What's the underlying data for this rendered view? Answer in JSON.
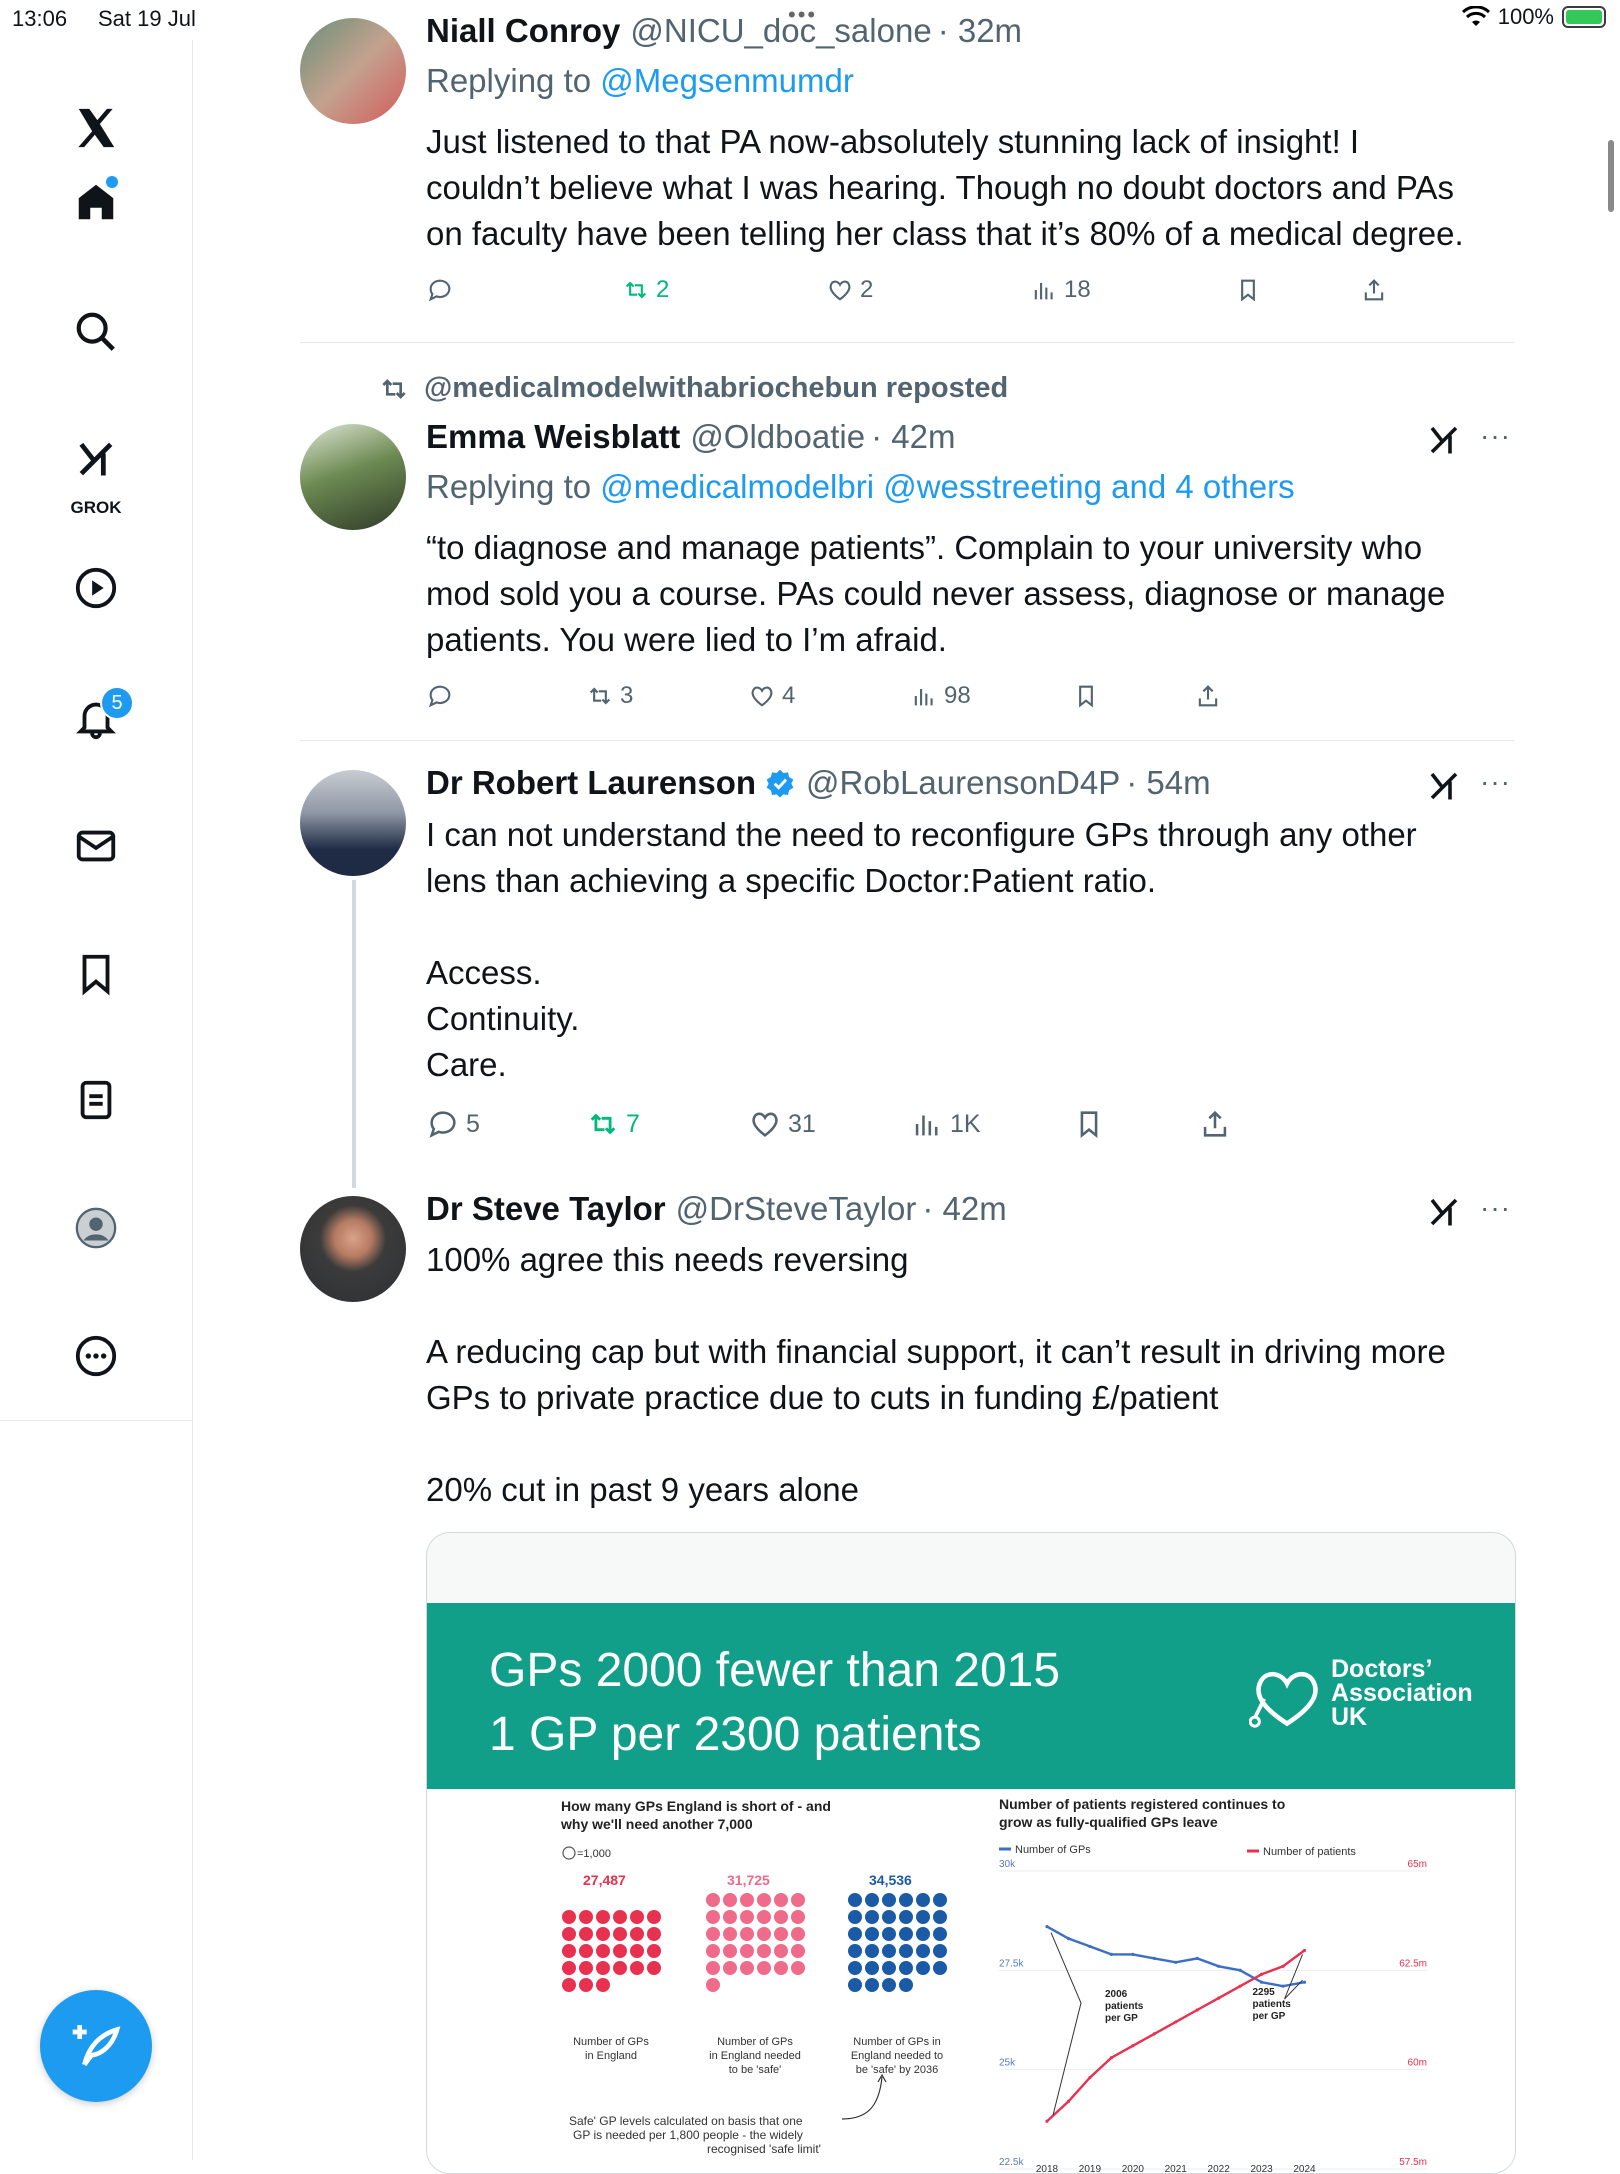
{
  "status_bar": {
    "time": "13:06",
    "date": "Sat 19 Jul",
    "battery": "100%"
  },
  "sidebar": {
    "grok_label": "GROK",
    "notification_count": "5"
  },
  "tweets": [
    {
      "name": "Niall Conroy",
      "handle": "@NICU_doc_salone",
      "time": "· 32m",
      "replying_prefix": "Replying to ",
      "replying_to": "@Megsenmumdr",
      "text": "Just listened to that PA now-absolutely stunning lack of insight! I\ncouldn’t believe what I was hearing. Though no doubt doctors and PAs\non faculty have been telling her class that it’s 80% of a medical degree.",
      "replies": "",
      "reposts": "2",
      "likes": "2",
      "views": "18"
    },
    {
      "reposted_by": "@medicalmodelwithabriochebun reposted",
      "name": "Emma Weisblatt",
      "handle": "@Oldboatie",
      "time": "· 42m",
      "replying_prefix": "Replying to ",
      "replying_to": "@medicalmodelbri @wesstreeting and 4 others",
      "text": "“to diagnose and manage patients”. Complain to your university who\nmod sold you a course. PAs could never assess, diagnose or manage\npatients. You were lied to I’m afraid.",
      "replies": "",
      "reposts": "3",
      "likes": "4",
      "views": "98"
    },
    {
      "name": "Dr Robert Laurenson",
      "handle": "@RobLaurensonD4P",
      "time": "· 54m",
      "text": "I can not understand the need to reconfigure GPs through any other\nlens than achieving a specific Doctor:Patient ratio.\n\nAccess.\nContinuity.\nCare.",
      "replies": "5",
      "reposts": "7",
      "likes": "31",
      "views": "1K"
    },
    {
      "name": "Dr Steve Taylor",
      "handle": "@DrSteveTaylor",
      "time": "· 42m",
      "text": "100% agree this needs reversing\n\nA reducing cap but with financial support, it can’t result in driving more\nGPs to private practice due to cuts in funding £/patient\n\n20% cut in past 9 years alone"
    }
  ],
  "card": {
    "banner_line1": "GPs 2000 fewer than 2015",
    "banner_line2": "1 GP per 2300 patients",
    "org_line1": "Doctors’",
    "org_line2": "Association",
    "org_line3": "UK",
    "left_title_1": "How many GPs England is short of - and",
    "left_title_2": "why we'll need another 7,000",
    "legend_unit": "=1,000",
    "groups": [
      {
        "value": "27,487",
        "label_1": "Number of GPs",
        "label_2": "in England",
        "label_3": "",
        "color": "#e8304f"
      },
      {
        "value": "31,725",
        "label_1": "Number of GPs",
        "label_2": "in England needed",
        "label_3": "to be 'safe'",
        "color": "#f06b8a"
      },
      {
        "value": "34,536",
        "label_1": "Number of GPs in",
        "label_2": "England needed to",
        "label_3": "be 'safe' by 2036",
        "color": "#1a5aa6"
      }
    ],
    "footnote_1": "Safe' GP levels calculated on basis that one",
    "footnote_2": "GP is needed per 1,800 people - the widely",
    "footnote_3": "recognised 'safe limit'",
    "right_title_1": "Number of patients registered continues to",
    "right_title_2": "grow as fully-qualified GPs leave",
    "legend_gps": "Number of GPs",
    "legend_patients": "Number of patients",
    "gp_color": "#3a6fc4",
    "patient_color": "#e8304f",
    "y_left": [
      "30k",
      "27.5k",
      "25k",
      "22.5k"
    ],
    "y_right": [
      "65m",
      "62.5m",
      "60m",
      "57.5m"
    ],
    "x_ticks": [
      "2018",
      "2019",
      "2020",
      "2021",
      "2022",
      "2023",
      "2024"
    ],
    "annot_left_1": "2006",
    "annot_left_2": "patients",
    "annot_left_3": "per GP",
    "annot_right_1": "2295",
    "annot_right_2": "patients",
    "annot_right_3": "per GP"
  },
  "chart_data": {
    "type": "line",
    "title": "Number of patients registered continues to grow as fully-qualified GPs leave",
    "x": [
      2018,
      2018.5,
      2019,
      2019.5,
      2020,
      2020.5,
      2021,
      2021.5,
      2022,
      2022.5,
      2023,
      2023.5,
      2024
    ],
    "series": [
      {
        "name": "Number of GPs",
        "axis": "left",
        "values": [
          28400,
          28100,
          27900,
          27700,
          27700,
          27600,
          27500,
          27600,
          27400,
          27300,
          27000,
          26900,
          27000
        ]
      },
      {
        "name": "Number of patients",
        "axis": "right",
        "values": [
          58500,
          59000,
          59600,
          60100,
          60400,
          60700,
          61000,
          61300,
          61600,
          61900,
          62200,
          62400,
          62800
        ]
      }
    ],
    "ylim_left": [
      22500,
      30000
    ],
    "ylim_right": [
      57500,
      65000
    ],
    "legend": "top"
  }
}
